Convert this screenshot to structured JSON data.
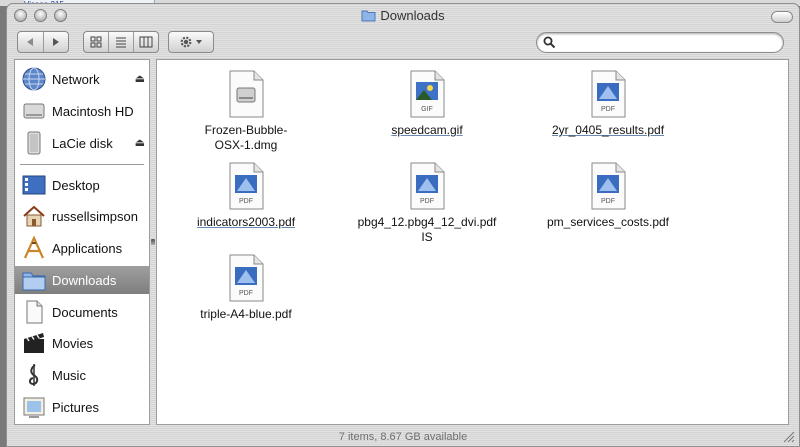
{
  "window": {
    "title": "Downloads",
    "background_window_label": "Visage 215"
  },
  "toolbar": {
    "back_label": "◀",
    "forward_label": "▶",
    "search_placeholder": "",
    "view_icon_label": "icon view",
    "view_list_label": "list view",
    "view_column_label": "column view",
    "action_menu_label": "action menu"
  },
  "sidebar": {
    "devices": [
      {
        "label": "Network",
        "icon": "globe-icon",
        "eject": true
      },
      {
        "label": "Macintosh HD",
        "icon": "hard-drive-icon",
        "eject": false
      },
      {
        "label": "LaCie disk",
        "icon": "external-drive-icon",
        "eject": true
      }
    ],
    "places": [
      {
        "label": "Desktop",
        "icon": "desktop-icon"
      },
      {
        "label": "russellsimpson",
        "icon": "home-icon"
      },
      {
        "label": "Applications",
        "icon": "applications-icon"
      },
      {
        "label": "Downloads",
        "icon": "downloads-folder-icon",
        "selected": true
      },
      {
        "label": "Documents",
        "icon": "documents-icon"
      },
      {
        "label": "Movies",
        "icon": "movies-icon"
      },
      {
        "label": "Music",
        "icon": "music-icon"
      },
      {
        "label": "Pictures",
        "icon": "pictures-icon"
      }
    ],
    "eject_glyph": "⏏"
  },
  "files": [
    {
      "line1": "Frozen-Bubble-",
      "line2": "OSX-1.dmg",
      "type": "dmg",
      "badge": ""
    },
    {
      "line1": "speedcam.gif",
      "line2": "",
      "type": "gif",
      "badge": "GIF"
    },
    {
      "line1": "2yr_0405_results.pdf",
      "line2": "",
      "type": "pdf",
      "badge": "PDF"
    },
    {
      "line1": "indicators2003.pdf",
      "line2": "",
      "type": "pdf",
      "badge": "PDF"
    },
    {
      "line1": "pbg4_12.pbg4_12_dvi.pdf",
      "line2": "IS",
      "type": "pdf",
      "badge": "PDF"
    },
    {
      "line1": "pm_services_costs.pdf",
      "line2": "",
      "type": "pdf",
      "badge": "PDF"
    },
    {
      "line1": "triple-A4-blue.pdf",
      "line2": "",
      "type": "pdf",
      "badge": "PDF"
    }
  ],
  "status": {
    "text": "7 items, 8.67 GB available"
  },
  "colors": {
    "selection": "#8a8a8a",
    "pdf_badge": "#2b63b5",
    "link_underline": "#6a8ab6"
  }
}
